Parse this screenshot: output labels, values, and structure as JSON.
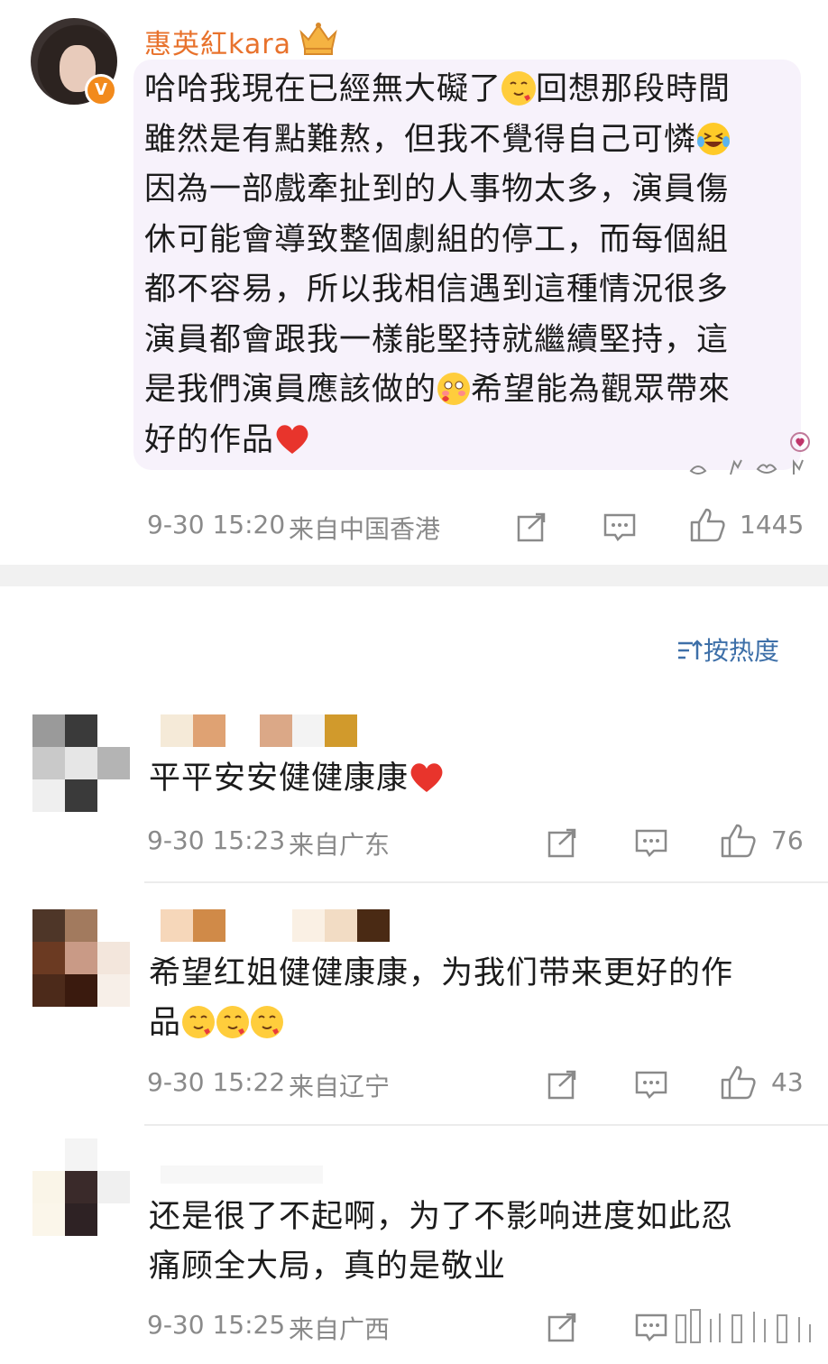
{
  "post": {
    "author": "惠英紅kara",
    "lines": [
      "哈哈我現在已經無大礙了",
      "回想那段時間",
      "雖然是有點難熬，但我不覺得自己可憐",
      "因為一部戲牽扯到的人事物太多，演員傷",
      "休可能會導致整個劇組的停工，而每個組",
      "都不容易，所以我相信遇到這種情況很多",
      "演員都會跟我一樣能堅持就繼續堅持，這",
      "是我們演員應該做的",
      "希望能為觀眾帶來",
      "好的作品"
    ],
    "time": "9-30 15:20",
    "source": "来自中国香港",
    "likes": "1445",
    "badge": "V"
  },
  "sort_label": "按热度",
  "comments": [
    {
      "text": "平平安安健健康康",
      "time": "9-30 15:23",
      "source": "来自广东",
      "likes": "76"
    },
    {
      "text_line1": "希望红姐健健康康，为我们带来更好的作",
      "text_line2": "品",
      "time": "9-30 15:22",
      "source": "来自辽宁",
      "likes": "43"
    },
    {
      "text_line1": "还是很了不起啊，为了不影响进度如此忍",
      "text_line2": "痛顾全大局，真的是敬业",
      "time": "9-30 15:25",
      "source": "来自广西"
    }
  ],
  "icons": {
    "share": "share-icon",
    "comment": "comment-icon",
    "like": "thumbs-up-icon",
    "sort": "sort-icon"
  },
  "colors": {
    "author_name": "#e8722c",
    "meta_text": "#8a8a8a",
    "sort_link": "#3d6fa8",
    "bubble_bg": "#f7f2fb",
    "badge": "#f28a1c"
  }
}
